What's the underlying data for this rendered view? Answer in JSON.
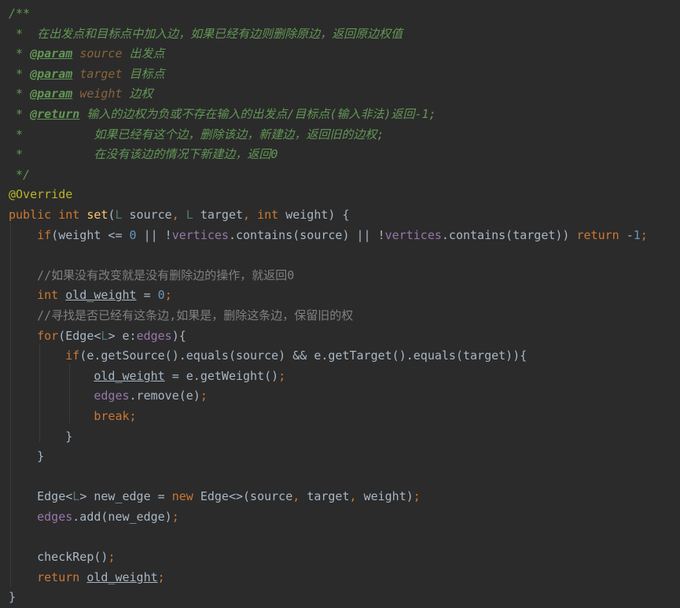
{
  "editor": {
    "lines": [
      [
        {
          "t": "/**",
          "c": "comment"
        }
      ],
      [
        {
          "t": " *  在出发点和目标点中加入边，如果已经有边则删除原边，返回原边权值",
          "c": "comment"
        }
      ],
      [
        {
          "t": " * ",
          "c": "comment"
        },
        {
          "t": "@param",
          "c": "doctag"
        },
        {
          "t": " ",
          "c": "comment"
        },
        {
          "t": "source",
          "c": "docparam"
        },
        {
          "t": " 出发点",
          "c": "comment"
        }
      ],
      [
        {
          "t": " * ",
          "c": "comment"
        },
        {
          "t": "@param",
          "c": "doctag"
        },
        {
          "t": " ",
          "c": "comment"
        },
        {
          "t": "target",
          "c": "docparam"
        },
        {
          "t": " 目标点",
          "c": "comment"
        }
      ],
      [
        {
          "t": " * ",
          "c": "comment"
        },
        {
          "t": "@param",
          "c": "doctag"
        },
        {
          "t": " ",
          "c": "comment"
        },
        {
          "t": "weight",
          "c": "docparam"
        },
        {
          "t": " 边权",
          "c": "comment"
        }
      ],
      [
        {
          "t": " * ",
          "c": "comment"
        },
        {
          "t": "@return",
          "c": "doctag"
        },
        {
          "t": " 输入的边权为负或不存在输入的出发点/目标点(输入非法)返回-1;",
          "c": "comment"
        }
      ],
      [
        {
          "t": " *          如果已经有这个边，删除该边，新建边，返回旧的边权;",
          "c": "comment"
        }
      ],
      [
        {
          "t": " *          在没有该边的情况下新建边，返回0",
          "c": "comment"
        }
      ],
      [
        {
          "t": " */",
          "c": "comment"
        }
      ],
      [
        {
          "t": "@Override",
          "c": "annotation"
        }
      ],
      [
        {
          "t": "public int ",
          "c": "keyword"
        },
        {
          "t": "set",
          "c": "method"
        },
        {
          "t": "(",
          "c": "plain"
        },
        {
          "t": "L",
          "c": "type"
        },
        {
          "t": " source",
          "c": "plain"
        },
        {
          "t": ", ",
          "c": "keyword"
        },
        {
          "t": "L",
          "c": "type"
        },
        {
          "t": " target",
          "c": "plain"
        },
        {
          "t": ", ",
          "c": "keyword"
        },
        {
          "t": "int ",
          "c": "keyword"
        },
        {
          "t": "weight) {",
          "c": "plain"
        }
      ],
      [
        {
          "t": "    ",
          "c": "plain"
        },
        {
          "t": "if",
          "c": "keyword"
        },
        {
          "t": "(weight <= ",
          "c": "plain"
        },
        {
          "t": "0",
          "c": "number"
        },
        {
          "t": " || !",
          "c": "plain"
        },
        {
          "t": "vertices",
          "c": "field"
        },
        {
          "t": ".contains(source) || !",
          "c": "plain"
        },
        {
          "t": "vertices",
          "c": "field"
        },
        {
          "t": ".contains(target)) ",
          "c": "plain"
        },
        {
          "t": "return ",
          "c": "keyword"
        },
        {
          "t": "-",
          "c": "plain"
        },
        {
          "t": "1",
          "c": "number"
        },
        {
          "t": ";",
          "c": "keyword"
        }
      ],
      [],
      [
        {
          "t": "    ",
          "c": "plain"
        },
        {
          "t": "//如果没有改变就是没有删除边的操作，就返回0",
          "c": "linecomment"
        }
      ],
      [
        {
          "t": "    ",
          "c": "plain"
        },
        {
          "t": "int ",
          "c": "keyword"
        },
        {
          "t": "old_weight",
          "c": "underline"
        },
        {
          "t": " = ",
          "c": "plain"
        },
        {
          "t": "0",
          "c": "number"
        },
        {
          "t": ";",
          "c": "keyword"
        }
      ],
      [
        {
          "t": "    ",
          "c": "plain"
        },
        {
          "t": "//寻找是否已经有这条边,如果是，删除这条边，保留旧的权",
          "c": "linecomment"
        }
      ],
      [
        {
          "t": "    ",
          "c": "plain"
        },
        {
          "t": "for",
          "c": "keyword"
        },
        {
          "t": "(Edge<",
          "c": "plain"
        },
        {
          "t": "L",
          "c": "type"
        },
        {
          "t": "> e:",
          "c": "plain"
        },
        {
          "t": "edges",
          "c": "field"
        },
        {
          "t": "){",
          "c": "plain"
        }
      ],
      [
        {
          "t": "        ",
          "c": "plain"
        },
        {
          "t": "if",
          "c": "keyword"
        },
        {
          "t": "(e.getSource().equals(source) && e.getTarget().equals(target)){",
          "c": "plain"
        }
      ],
      [
        {
          "t": "            ",
          "c": "plain"
        },
        {
          "t": "old_weight",
          "c": "underline"
        },
        {
          "t": " = e.getWeight()",
          "c": "plain"
        },
        {
          "t": ";",
          "c": "keyword"
        }
      ],
      [
        {
          "t": "            ",
          "c": "plain"
        },
        {
          "t": "edges",
          "c": "field"
        },
        {
          "t": ".remove(e)",
          "c": "plain"
        },
        {
          "t": ";",
          "c": "keyword"
        }
      ],
      [
        {
          "t": "            ",
          "c": "plain"
        },
        {
          "t": "break;",
          "c": "keyword"
        }
      ],
      [
        {
          "t": "        }",
          "c": "plain"
        }
      ],
      [
        {
          "t": "    }",
          "c": "plain"
        }
      ],
      [],
      [
        {
          "t": "    Edge<",
          "c": "plain"
        },
        {
          "t": "L",
          "c": "type"
        },
        {
          "t": "> new_edge = ",
          "c": "plain"
        },
        {
          "t": "new ",
          "c": "keyword"
        },
        {
          "t": "Edge<>(source",
          "c": "plain"
        },
        {
          "t": ", ",
          "c": "keyword"
        },
        {
          "t": "target",
          "c": "plain"
        },
        {
          "t": ", ",
          "c": "keyword"
        },
        {
          "t": "weight)",
          "c": "plain"
        },
        {
          "t": ";",
          "c": "keyword"
        }
      ],
      [
        {
          "t": "    ",
          "c": "plain"
        },
        {
          "t": "edges",
          "c": "field"
        },
        {
          "t": ".add(new_edge)",
          "c": "plain"
        },
        {
          "t": ";",
          "c": "keyword"
        }
      ],
      [],
      [
        {
          "t": "    checkRep()",
          "c": "plain"
        },
        {
          "t": ";",
          "c": "keyword"
        }
      ],
      [
        {
          "t": "    ",
          "c": "plain"
        },
        {
          "t": "return ",
          "c": "keyword"
        },
        {
          "t": "old_weight",
          "c": "underline"
        },
        {
          "t": ";",
          "c": "keyword"
        }
      ],
      [
        {
          "t": "}",
          "c": "plain"
        }
      ]
    ]
  }
}
